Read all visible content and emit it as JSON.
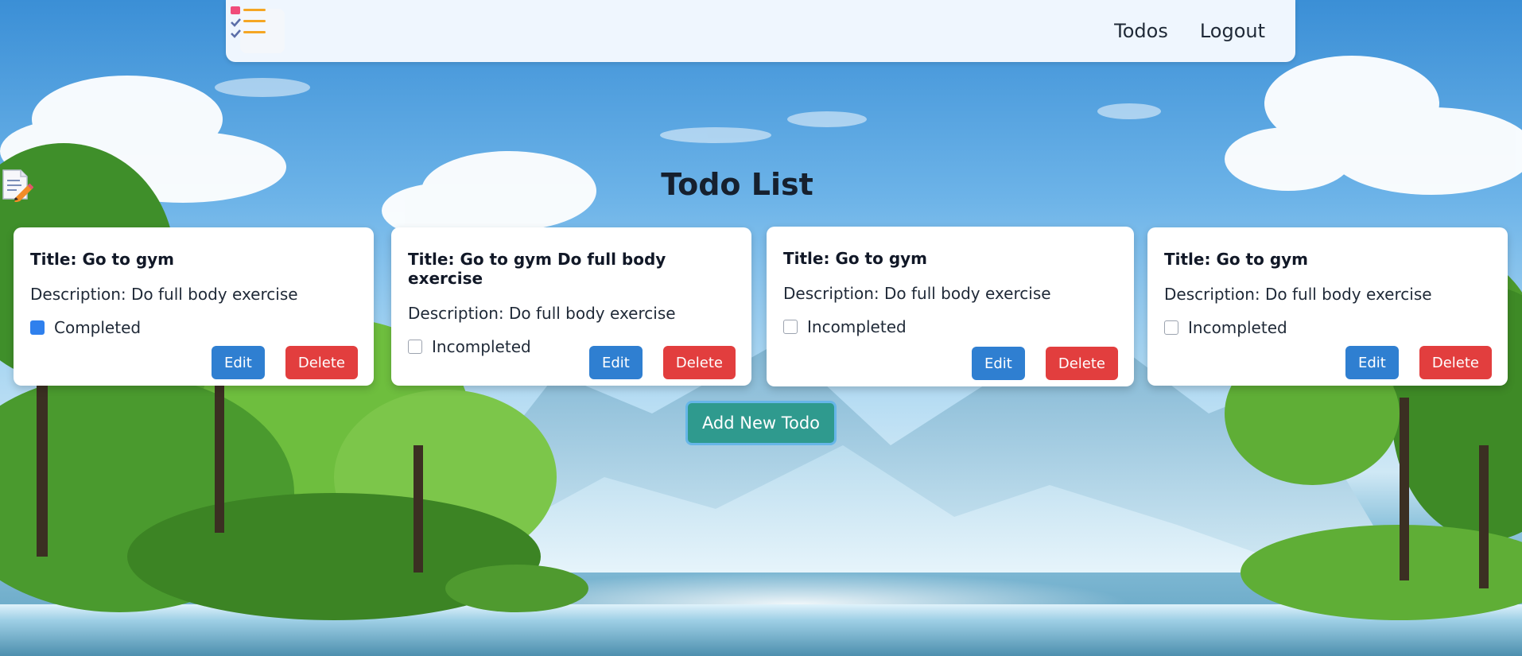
{
  "navbar": {
    "logo_icon": "checklist-icon",
    "links": [
      "Todos",
      "Logout"
    ]
  },
  "page": {
    "title": "Todo List",
    "title_icon": "memo-icon"
  },
  "todos": [
    {
      "title": "Title: Go to gym",
      "description": "Description: Do full body exercise",
      "status": "Completed",
      "completed": true,
      "edit_label": "Edit",
      "delete_label": "Delete"
    },
    {
      "title": "Title: Go to gym Do full body exercise",
      "description": "Description: Do full body exercise",
      "status": "Incompleted",
      "completed": false,
      "edit_label": "Edit",
      "delete_label": "Delete"
    },
    {
      "title": "Title: Go to gym",
      "description": "Description: Do full body exercise",
      "status": "Incompleted",
      "completed": false,
      "edit_label": "Edit",
      "delete_label": "Delete"
    },
    {
      "title": "Title: Go to gym",
      "description": "Description: Do full body exercise",
      "status": "Incompleted",
      "completed": false,
      "edit_label": "Edit",
      "delete_label": "Delete"
    }
  ],
  "add_button": "Add New Todo",
  "colors": {
    "navbar_bg": "#eff6fe",
    "edit": "#2f7fd1",
    "delete": "#e23e3e",
    "add": "#2f9a8e",
    "checkbox_checked": "#2f80ed"
  }
}
